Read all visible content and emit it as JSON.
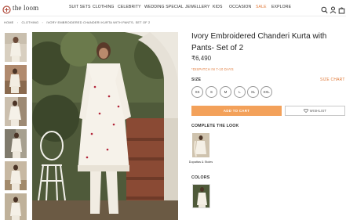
{
  "brand": {
    "name": "the loom"
  },
  "nav": {
    "items": [
      "SUIT SETS",
      "CLOTHING",
      "CELEBRITY",
      "WEDDING SPECIAL",
      "JEWELLERY",
      "KIDS",
      "OCCASION",
      "SALE",
      "EXPLORE"
    ],
    "sale_color": "#e07a3a"
  },
  "header_icons": [
    "search-icon",
    "user-icon",
    "bag-icon"
  ],
  "breadcrumb": [
    "HOME",
    "CLOTHING",
    "IVORY EMBROIDERED CHANDERI KURTA WITH PANTS- SET OF 2"
  ],
  "breadcrumb_sep": "›",
  "product": {
    "title": "Ivory Embroidered Chanderi Kurta with Pants- Set of 2",
    "price": "₹6,490",
    "dispatch": "*DISPATCH IN 7-10 DAYS",
    "size_label": "SIZE",
    "size_chart": "SIZE CHART",
    "sizes": [
      "XS",
      "S",
      "M",
      "L",
      "XL",
      "XXL"
    ],
    "add_to_cart": "ADD TO CART",
    "wishlist": "WISHLIST",
    "complete_the_look": "COMPLETE THE LOOK",
    "look_item": "Dupattas & Stoles",
    "colors_label": "COLORS"
  },
  "accent_color": "#f3a15a",
  "thumbnail_count": 6
}
